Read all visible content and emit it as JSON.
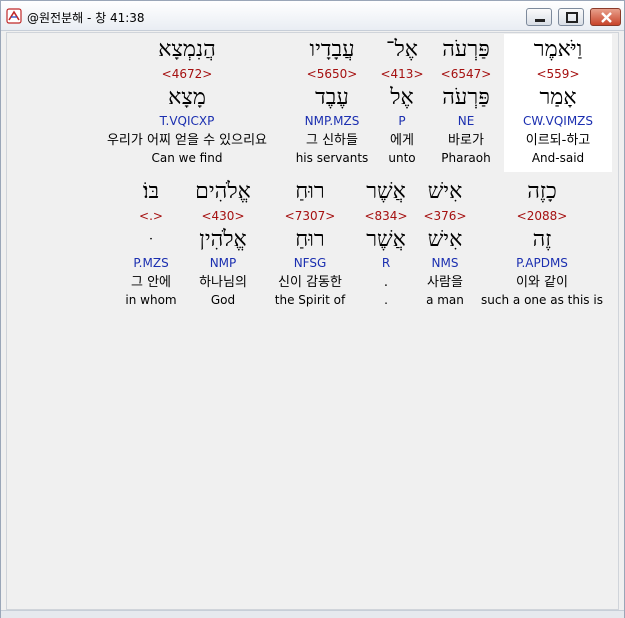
{
  "window": {
    "title": "@원전분해 - 창 41:38",
    "minimize_label": "",
    "maximize_label": "",
    "close_label": ""
  },
  "row1": [
    {
      "surface": "וַיֹּאמֶר",
      "strong": "<559>",
      "lemma": "אָמַר",
      "morph": "CW.VQIMZS",
      "korean": "이르되-하고",
      "english": "And-said",
      "highlight": true
    },
    {
      "surface": "פַּרְעֹה",
      "strong": "<6547>",
      "lemma": "פַּרְעֹה",
      "morph": "NE",
      "korean": "바로가",
      "english": "Pharaoh"
    },
    {
      "surface": "אֶל־",
      "strong": "<413>",
      "lemma": "אֶל",
      "morph": "P",
      "korean": "에게",
      "english": "unto"
    },
    {
      "surface": "עֲבָדָיו",
      "strong": "<5650>",
      "lemma": "עֶבֶד",
      "morph": "NMP.MZS",
      "korean": "그 신하들",
      "english": "his servants"
    },
    {
      "surface": "הֲנִמְצָא",
      "strong": "<4672>",
      "lemma": "מָצָא",
      "morph": "T.VQICXP",
      "korean": "우리가 어찌 얻을 수 있으리요",
      "english": "Can we find"
    }
  ],
  "row2": [
    {
      "surface": "כָזֶה",
      "strong": "<2088>",
      "lemma": "זֶה",
      "morph": "P.APDMS",
      "korean": "이와 같이",
      "english": "such a one as this is"
    },
    {
      "surface": "אִישׁ",
      "strong": "<376>",
      "lemma": "אִישׁ",
      "morph": "NMS",
      "korean": "사람을",
      "english": "a man"
    },
    {
      "surface": "אֲשֶׁר",
      "strong": "<834>",
      "lemma": "אֲשֶׁר",
      "morph": "R",
      "korean": ".",
      "english": "."
    },
    {
      "surface": "רוּחַ",
      "strong": "<7307>",
      "lemma": "רוּחַ",
      "morph": "NFSG",
      "korean": "신이 감동한",
      "english": "the Spirit of"
    },
    {
      "surface": "אֱלֹהִים",
      "strong": "<430>",
      "lemma": "אֱלֹהִין",
      "morph": "NMP",
      "korean": "하나님의",
      "english": "God"
    },
    {
      "surface": "בּוֹ׃",
      "strong": "<.>",
      "lemma": "ּ",
      "morph": "P.MZS",
      "korean": "그 안에",
      "english": "in whom"
    }
  ]
}
